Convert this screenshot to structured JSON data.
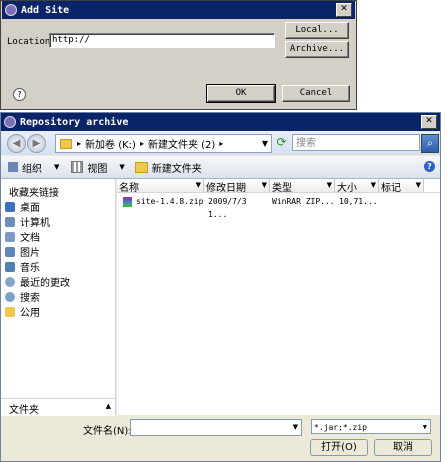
{
  "add_site": {
    "title": "Add Site",
    "location_label": "Location:",
    "location_value": "http://",
    "local_button": "Local...",
    "archive_button": "Archive...",
    "ok_button": "OK",
    "cancel_button": "Cancel",
    "help_icon": "?",
    "close_icon": "✕"
  },
  "repo": {
    "title": "Repository archive",
    "close_icon": "✕",
    "breadcrumb": [
      "新加卷 (K:)",
      "新建文件夹 (2)"
    ],
    "search_placeholder": "搜索",
    "toolbar": {
      "organize": "组织",
      "views": "视图",
      "new_folder": "新建文件夹"
    },
    "sidebar_header": "收藏夹链接",
    "sidebar_items": [
      {
        "label": "桌面",
        "icon": "desktop-icon"
      },
      {
        "label": "计算机",
        "icon": "computer-icon"
      },
      {
        "label": "文档",
        "icon": "documents-icon"
      },
      {
        "label": "图片",
        "icon": "pictures-icon"
      },
      {
        "label": "音乐",
        "icon": "music-icon"
      },
      {
        "label": "最近的更改",
        "icon": "recent-icon"
      },
      {
        "label": "搜索",
        "icon": "search-icon"
      },
      {
        "label": "公用",
        "icon": "public-icon"
      }
    ],
    "folders_label": "文件夹",
    "columns": [
      "名称",
      "修改日期",
      "类型",
      "大小",
      "标记"
    ],
    "files": [
      {
        "name": "site-1.4.8.zip",
        "date": "2009/7/3 1...",
        "type": "WinRAR ZIP...",
        "size": "10,71...",
        "tag": ""
      }
    ],
    "filename_label": "文件名(N):",
    "filename_value": "",
    "filter_value": "*.jar;*.zip",
    "open_button": "打开(O)",
    "cancel_button": "取消",
    "help_icon": "?"
  }
}
